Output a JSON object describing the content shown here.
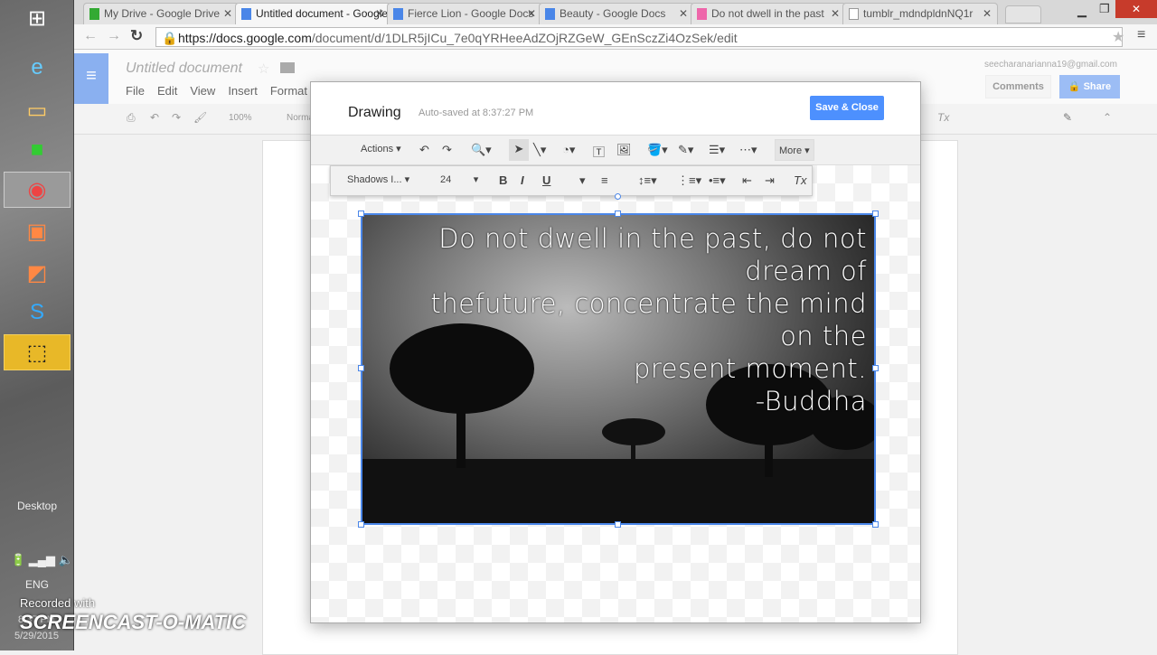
{
  "browser": {
    "tabs": [
      {
        "label": "My Drive - Google Drive",
        "active": false
      },
      {
        "label": "Untitled document - Google Docs",
        "active": true
      },
      {
        "label": "Fierce Lion - Google Docs",
        "active": false
      },
      {
        "label": "Beauty - Google Docs",
        "active": false
      },
      {
        "label": "Do not dwell in the past",
        "active": false
      },
      {
        "label": "tumblr_mdndpldnNQ1r",
        "active": false
      }
    ],
    "url_host": "https://docs.google.com",
    "url_path": "/document/d/1DLR5jICu_7e0qYRHeeAdZOjRZGeW_GEnSczZi4OzSek/edit"
  },
  "taskbar": {
    "desktop_label": "Desktop",
    "lang": "ENG",
    "time": "8:37 PM",
    "date": "5/29/2015"
  },
  "watermark": {
    "recorded": "Recorded with",
    "brand": "SCREENCAST-O-MATIC"
  },
  "docs": {
    "title": "Untitled document",
    "menu": [
      "File",
      "Edit",
      "View",
      "Insert",
      "Format"
    ],
    "zoom": "100%",
    "style": "Normal",
    "account": "seecharanarianna19@gmail.com",
    "comments": "Comments",
    "share": "Share"
  },
  "drawing": {
    "title": "Drawing",
    "autosave": "Auto-saved at 8:37:27 PM",
    "save_close": "Save & Close",
    "actions": "Actions",
    "more": "More",
    "font": "Shadows I...",
    "font_size": "24",
    "bold": "B",
    "italic": "I",
    "underline": "U",
    "quote_lines": [
      "Do not dwell in the past, do not dream of",
      "thefuture, concentrate the mind on the",
      "present moment.",
      "-Buddha"
    ]
  },
  "colors": {
    "accent": "#4a86e8",
    "save_button": "#4d90fe"
  }
}
